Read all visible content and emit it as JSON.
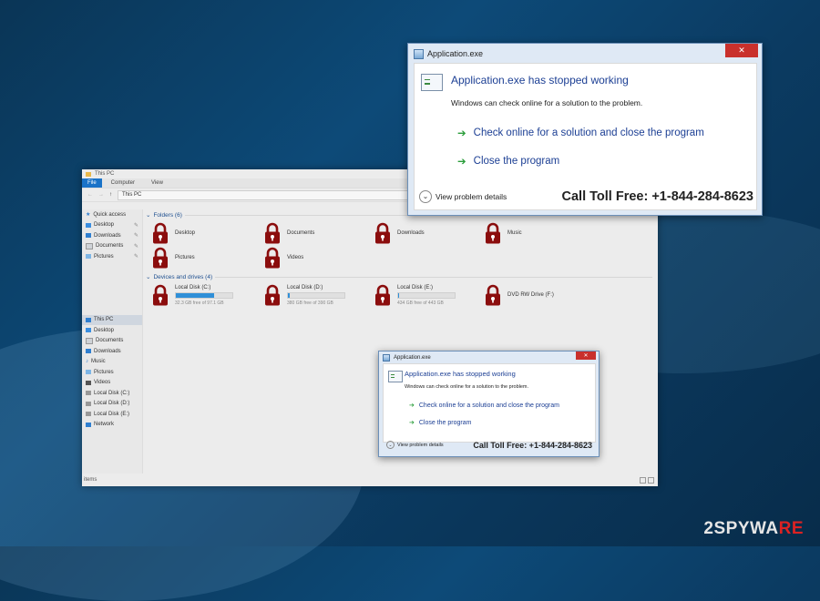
{
  "explorer": {
    "title": "This PC",
    "ribbon_file": "File",
    "ribbon_tabs": [
      "Computer",
      "View"
    ],
    "address": "This PC",
    "quick_access_label": "Quick access",
    "quick_items": [
      "Desktop",
      "Downloads",
      "Documents",
      "Pictures"
    ],
    "nav_items": [
      "This PC",
      "Desktop",
      "Documents",
      "Downloads",
      "Music",
      "Pictures",
      "Videos",
      "Local Disk (C:)",
      "Local Disk (D:)",
      "Local Disk (E:)",
      "Network"
    ],
    "folders_header": "Folders (6)",
    "folders": [
      "Desktop",
      "Documents",
      "Downloads",
      "Music",
      "Pictures",
      "Videos"
    ],
    "drives_header": "Devices and drives (4)",
    "drives": [
      {
        "name": "Local Disk (C:)",
        "free": "32.3 GB free of 97.1 GB",
        "used_fraction": 0.67
      },
      {
        "name": "Local Disk (D:)",
        "free": "380 GB free of 390 GB",
        "used_fraction": 0.03
      },
      {
        "name": "Local Disk (E:)",
        "free": "434 GB free of 443 GB",
        "used_fraction": 0.02
      },
      {
        "name": "DVD RW Drive (F:)",
        "free": "",
        "used_fraction": 0
      }
    ],
    "status": "items",
    "lock_color": "#8b0d0d"
  },
  "dialog": {
    "title": "Application.exe",
    "close": "✕",
    "heading": "Application.exe has stopped working",
    "sub": "Windows can check online for a solution to the problem.",
    "option1": "Check online for a solution and close the program",
    "option2": "Close the program",
    "details": "View problem details",
    "toll": "Call Toll Free: +1-844-284-8623"
  },
  "watermark": {
    "prefix": "2",
    "middle": "SPYWA",
    "re": "RE"
  }
}
